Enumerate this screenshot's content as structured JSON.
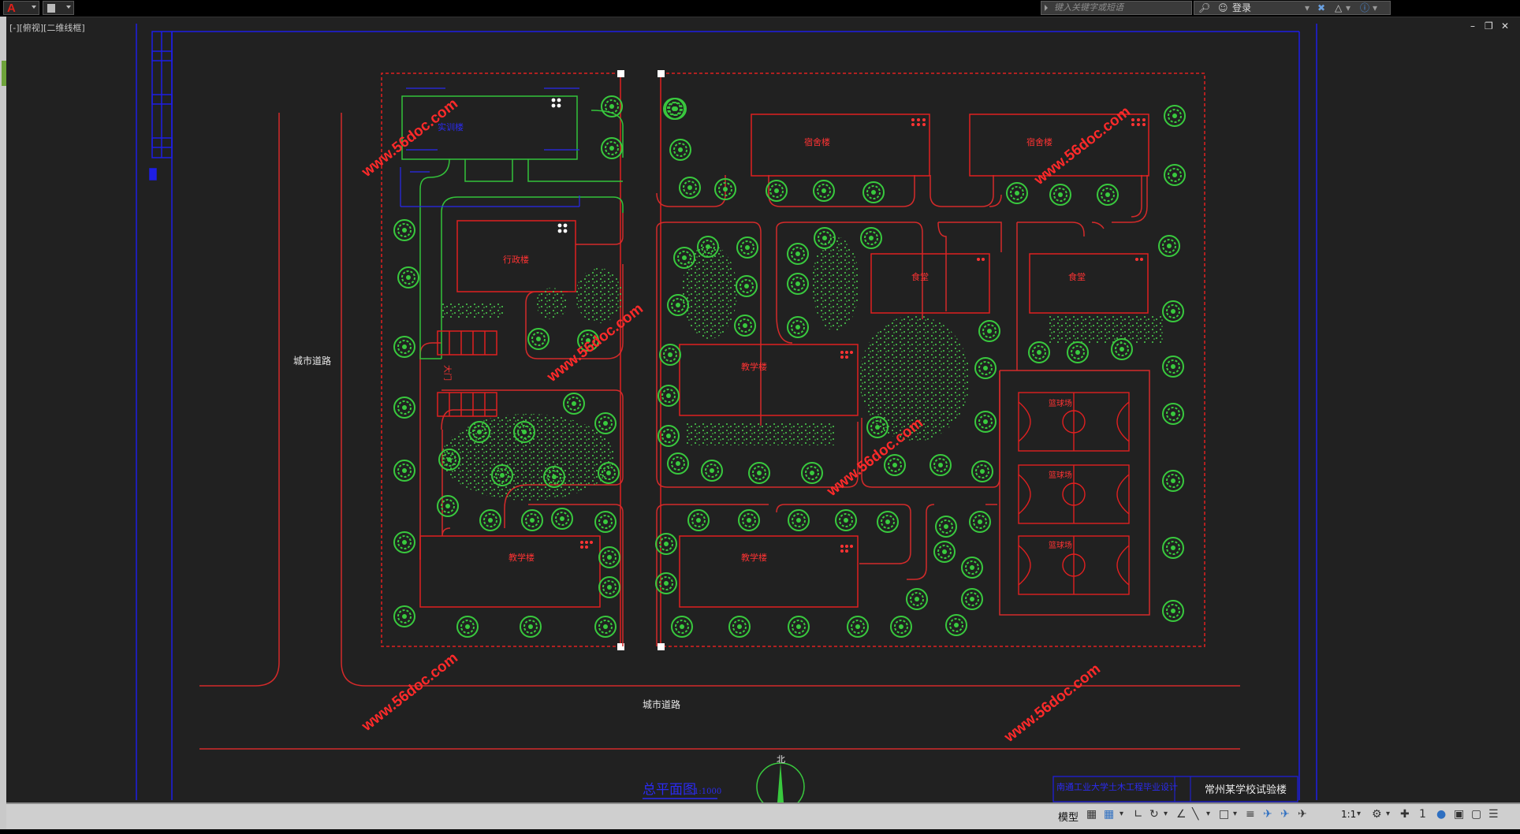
{
  "titlebar": {
    "search_placeholder": "键入关键字或短语",
    "login_label": "登录"
  },
  "viewport": {
    "label": "[-][俯视][二维线框]"
  },
  "drawing": {
    "buildings": {
      "admin": "行政楼",
      "dorm_1": "宿舍楼",
      "dorm_2": "宿舍楼",
      "canteen_1": "食堂",
      "canteen_2": "食堂",
      "teaching_1": "教学楼",
      "teaching_2": "教学楼",
      "teaching_3": "教学楼",
      "court_1": "篮球场",
      "court_2": "篮球场",
      "court_3": "篮球场",
      "small_building": "实训楼",
      "gate_label": "大门"
    },
    "roads": {
      "west": "城市道路",
      "south": "城市道路"
    },
    "watermark": "www.56doc.com",
    "north_label": "北",
    "plan_title": "总平面图",
    "plan_scale": "1:1000",
    "titleblock": {
      "school": "南通工业大学土木工程毕业设计",
      "project": "常州某学校试验楼"
    }
  },
  "statusbar": {
    "model_label": "模型",
    "scale": "1:1"
  },
  "colors": {
    "background": "#212121",
    "site_line": "#e02020",
    "tree": "#39c93e",
    "border": "#1a1ae0",
    "road": "#cc2222"
  }
}
